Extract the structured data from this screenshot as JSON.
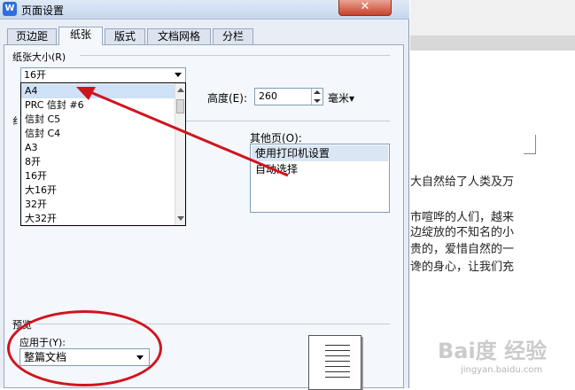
{
  "window": {
    "title": "页面设置",
    "close_icon": "✕",
    "app_icon": "W"
  },
  "tabs": [
    "页边距",
    "纸张",
    "版式",
    "文档网格",
    "分栏"
  ],
  "active_tab": "纸张",
  "paper_size": {
    "section_label": "纸张大小(R)",
    "selected": "16开",
    "options": [
      "A4",
      "PRC 信封 #6",
      "信封 C5",
      "信封 C4",
      "A3",
      "8开",
      "16开",
      "大16开",
      "32开",
      "大32开"
    ],
    "highlighted_option": "A4",
    "height_label": "高度(E):",
    "height_value": "260",
    "unit": "毫米▾",
    "partial_label": "纟"
  },
  "other_pages": {
    "label": "其他页(O):",
    "items": [
      "使用打印机设置",
      "自动选择"
    ],
    "selected_index": 0
  },
  "preview": {
    "section_label": "预览",
    "apply_label": "应用于(Y):",
    "apply_value": "整篇文档"
  },
  "document": {
    "lines": [
      "大自然给了人类及万",
      "市喧哗的人们，越来",
      "边绽放的不知名的小",
      "贵的，爱惜自然的一",
      "谗的身心，让我们充"
    ]
  },
  "watermark": {
    "text": "Bai度 经验",
    "sub": "jingyan.baidu.com"
  },
  "colors": {
    "annotation_red": "#d0141e",
    "selection_blue": "#cfe1f6",
    "dialog_bg": "#e9eef6"
  }
}
